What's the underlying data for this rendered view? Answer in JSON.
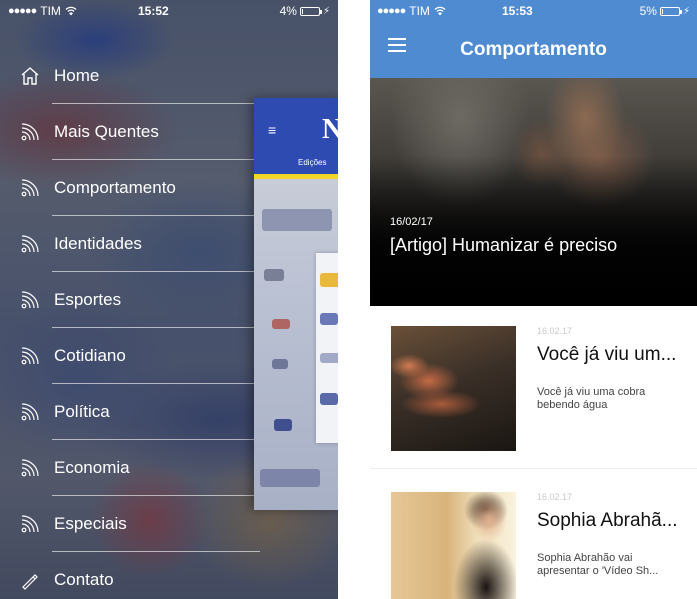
{
  "left_screen": {
    "status": {
      "carrier": "TIM",
      "time": "15:52",
      "battery": "4%",
      "battery_level": 0.04
    },
    "menu": [
      {
        "label": "Home",
        "icon": "home-icon"
      },
      {
        "label": "Mais Quentes",
        "icon": "rss-icon"
      },
      {
        "label": "Comportamento",
        "icon": "rss-icon"
      },
      {
        "label": "Identidades",
        "icon": "rss-icon"
      },
      {
        "label": "Esportes",
        "icon": "rss-icon"
      },
      {
        "label": "Cotidiano",
        "icon": "rss-icon"
      },
      {
        "label": "Política",
        "icon": "rss-icon"
      },
      {
        "label": "Economia",
        "icon": "rss-icon"
      },
      {
        "label": "Especiais",
        "icon": "rss-icon"
      },
      {
        "label": "Contato",
        "icon": "contact-icon"
      }
    ],
    "peek": {
      "logo": "N",
      "tab": "Edições"
    }
  },
  "right_screen": {
    "status": {
      "carrier": "TIM",
      "time": "15:53",
      "battery": "5%",
      "battery_level": 0.05
    },
    "nav_title": "Comportamento",
    "hero": {
      "date": "16/02/17",
      "title": "[Artigo] Humanizar é preciso"
    },
    "articles": [
      {
        "date": "16.02.17",
        "title": "Você já viu um...",
        "subtitle": "Você já viu uma cobra bebendo água"
      },
      {
        "date": "16.02.17",
        "title": "Sophia Abrahã...",
        "subtitle": "Sophia Abrahão vai apresentar o 'Vídeo Sh..."
      }
    ]
  },
  "colors": {
    "nav_blue": "#4e8bd0",
    "peek_blue": "#2d4bb0",
    "peek_yellow": "#f2d629"
  }
}
